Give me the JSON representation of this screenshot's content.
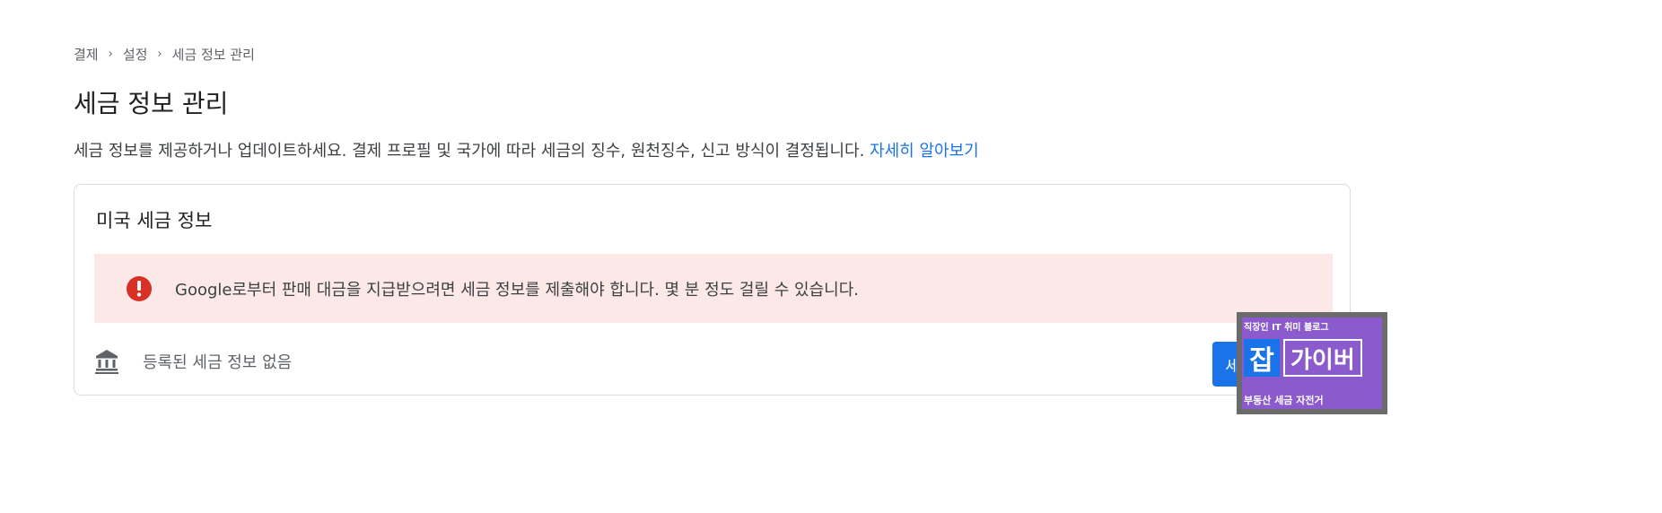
{
  "breadcrumb": {
    "items": [
      "결제",
      "설정",
      "세금 정보 관리"
    ],
    "separator": "›"
  },
  "page": {
    "title": "세금 정보 관리",
    "description": "세금 정보를 제공하거나 업데이트하세요. 결제 프로필 및 국가에 따라 세금의 징수, 원천징수, 신고 방식이 결정됩니다.",
    "learn_more": "자세히 알아보기"
  },
  "card": {
    "title": "미국 세금 정보",
    "alert": {
      "icon": "error-icon",
      "text": "Google로부터 판매 대금을 지급받으려면 세금 정보를 제출해야 합니다. 몇 분 정도 걸릴 수 있습니다."
    },
    "status": {
      "icon": "bank-icon",
      "text": "등록된 세금 정보 없음"
    },
    "add_button": "세금 정보 추가"
  },
  "watermark": {
    "top": "직장인 IT 취미 블로그",
    "big_char": "잡",
    "big_word": "가이버",
    "bottom": "부동산 세금 자전거"
  },
  "colors": {
    "accent": "#1a73e8",
    "alert_bg": "#fce8e6",
    "error": "#d93025"
  }
}
